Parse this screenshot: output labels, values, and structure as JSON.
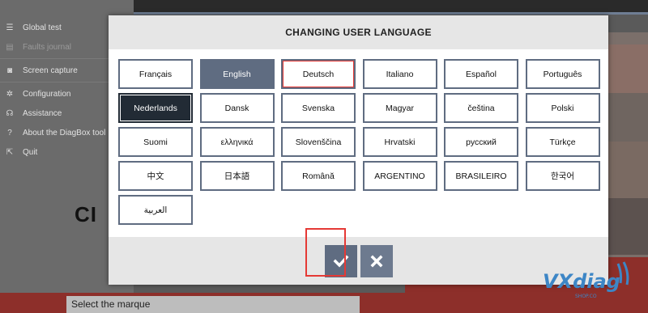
{
  "background": {
    "menu": [
      {
        "label": "Global test",
        "icon": "list-icon",
        "dim": false
      },
      {
        "label": "Faults journal",
        "icon": "journal-icon",
        "dim": true
      },
      {
        "label": "Screen capture",
        "icon": "camera-icon",
        "dim": false
      },
      {
        "label": "Configuration",
        "icon": "gear-icon",
        "dim": false
      },
      {
        "label": "Assistance",
        "icon": "headset-icon",
        "dim": false
      },
      {
        "label": "About the DiagBox tool",
        "icon": "help-icon",
        "dim": false
      },
      {
        "label": "Quit",
        "icon": "exit-icon",
        "dim": false
      }
    ],
    "big_text": "CI",
    "marque_placeholder": "Select the marque"
  },
  "dialog": {
    "title": "CHANGING USER LANGUAGE",
    "selected_language": "English",
    "current_language": "Nederlands",
    "highlighted_language": "Deutsch",
    "languages": [
      "Français",
      "English",
      "Deutsch",
      "Italiano",
      "Español",
      "Português",
      "Nederlands",
      "Dansk",
      "Svenska",
      "Magyar",
      "čeština",
      "Polski",
      "Suomi",
      "ελληνικά",
      "Slovenščina",
      "Hrvatski",
      "русский",
      "Türkçe",
      "中文",
      "日本語",
      "Română",
      "ARGENTINO",
      "BRASILEIRO",
      "한국어",
      "العربية"
    ],
    "confirm_icon": "check-icon",
    "cancel_icon": "close-icon"
  },
  "watermark": {
    "brand": "VXdiag",
    "sub": "SHOP.CO"
  },
  "colors": {
    "accent": "#5f6c81",
    "highlight": "#e53935",
    "current": "#222b35"
  }
}
